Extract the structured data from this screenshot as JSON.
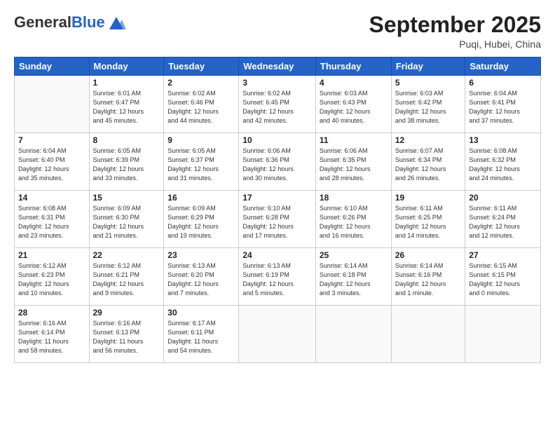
{
  "header": {
    "logo_line1": "General",
    "logo_line2": "Blue",
    "month_title": "September 2025",
    "location": "Puqi, Hubei, China"
  },
  "days_of_week": [
    "Sunday",
    "Monday",
    "Tuesday",
    "Wednesday",
    "Thursday",
    "Friday",
    "Saturday"
  ],
  "weeks": [
    [
      {
        "day": "",
        "info": ""
      },
      {
        "day": "1",
        "info": "Sunrise: 6:01 AM\nSunset: 6:47 PM\nDaylight: 12 hours\nand 45 minutes."
      },
      {
        "day": "2",
        "info": "Sunrise: 6:02 AM\nSunset: 6:46 PM\nDaylight: 12 hours\nand 44 minutes."
      },
      {
        "day": "3",
        "info": "Sunrise: 6:02 AM\nSunset: 6:45 PM\nDaylight: 12 hours\nand 42 minutes."
      },
      {
        "day": "4",
        "info": "Sunrise: 6:03 AM\nSunset: 6:43 PM\nDaylight: 12 hours\nand 40 minutes."
      },
      {
        "day": "5",
        "info": "Sunrise: 6:03 AM\nSunset: 6:42 PM\nDaylight: 12 hours\nand 38 minutes."
      },
      {
        "day": "6",
        "info": "Sunrise: 6:04 AM\nSunset: 6:41 PM\nDaylight: 12 hours\nand 37 minutes."
      }
    ],
    [
      {
        "day": "7",
        "info": "Sunrise: 6:04 AM\nSunset: 6:40 PM\nDaylight: 12 hours\nand 35 minutes."
      },
      {
        "day": "8",
        "info": "Sunrise: 6:05 AM\nSunset: 6:39 PM\nDaylight: 12 hours\nand 33 minutes."
      },
      {
        "day": "9",
        "info": "Sunrise: 6:05 AM\nSunset: 6:37 PM\nDaylight: 12 hours\nand 31 minutes."
      },
      {
        "day": "10",
        "info": "Sunrise: 6:06 AM\nSunset: 6:36 PM\nDaylight: 12 hours\nand 30 minutes."
      },
      {
        "day": "11",
        "info": "Sunrise: 6:06 AM\nSunset: 6:35 PM\nDaylight: 12 hours\nand 28 minutes."
      },
      {
        "day": "12",
        "info": "Sunrise: 6:07 AM\nSunset: 6:34 PM\nDaylight: 12 hours\nand 26 minutes."
      },
      {
        "day": "13",
        "info": "Sunrise: 6:08 AM\nSunset: 6:32 PM\nDaylight: 12 hours\nand 24 minutes."
      }
    ],
    [
      {
        "day": "14",
        "info": "Sunrise: 6:08 AM\nSunset: 6:31 PM\nDaylight: 12 hours\nand 23 minutes."
      },
      {
        "day": "15",
        "info": "Sunrise: 6:09 AM\nSunset: 6:30 PM\nDaylight: 12 hours\nand 21 minutes."
      },
      {
        "day": "16",
        "info": "Sunrise: 6:09 AM\nSunset: 6:29 PM\nDaylight: 12 hours\nand 19 minutes."
      },
      {
        "day": "17",
        "info": "Sunrise: 6:10 AM\nSunset: 6:28 PM\nDaylight: 12 hours\nand 17 minutes."
      },
      {
        "day": "18",
        "info": "Sunrise: 6:10 AM\nSunset: 6:26 PM\nDaylight: 12 hours\nand 16 minutes."
      },
      {
        "day": "19",
        "info": "Sunrise: 6:11 AM\nSunset: 6:25 PM\nDaylight: 12 hours\nand 14 minutes."
      },
      {
        "day": "20",
        "info": "Sunrise: 6:11 AM\nSunset: 6:24 PM\nDaylight: 12 hours\nand 12 minutes."
      }
    ],
    [
      {
        "day": "21",
        "info": "Sunrise: 6:12 AM\nSunset: 6:23 PM\nDaylight: 12 hours\nand 10 minutes."
      },
      {
        "day": "22",
        "info": "Sunrise: 6:12 AM\nSunset: 6:21 PM\nDaylight: 12 hours\nand 9 minutes."
      },
      {
        "day": "23",
        "info": "Sunrise: 6:13 AM\nSunset: 6:20 PM\nDaylight: 12 hours\nand 7 minutes."
      },
      {
        "day": "24",
        "info": "Sunrise: 6:13 AM\nSunset: 6:19 PM\nDaylight: 12 hours\nand 5 minutes."
      },
      {
        "day": "25",
        "info": "Sunrise: 6:14 AM\nSunset: 6:18 PM\nDaylight: 12 hours\nand 3 minutes."
      },
      {
        "day": "26",
        "info": "Sunrise: 6:14 AM\nSunset: 6:16 PM\nDaylight: 12 hours\nand 1 minute."
      },
      {
        "day": "27",
        "info": "Sunrise: 6:15 AM\nSunset: 6:15 PM\nDaylight: 12 hours\nand 0 minutes."
      }
    ],
    [
      {
        "day": "28",
        "info": "Sunrise: 6:16 AM\nSunset: 6:14 PM\nDaylight: 11 hours\nand 58 minutes."
      },
      {
        "day": "29",
        "info": "Sunrise: 6:16 AM\nSunset: 6:13 PM\nDaylight: 11 hours\nand 56 minutes."
      },
      {
        "day": "30",
        "info": "Sunrise: 6:17 AM\nSunset: 6:11 PM\nDaylight: 11 hours\nand 54 minutes."
      },
      {
        "day": "",
        "info": ""
      },
      {
        "day": "",
        "info": ""
      },
      {
        "day": "",
        "info": ""
      },
      {
        "day": "",
        "info": ""
      }
    ]
  ]
}
